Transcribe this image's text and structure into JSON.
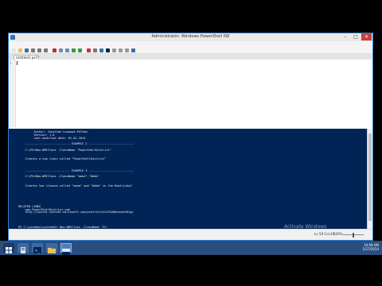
{
  "window": {
    "title": "Administrator: Windows PowerShell ISE",
    "minimize_glyph": "–",
    "maximize_glyph": "□",
    "close_glyph": "✕"
  },
  "menu": [
    "File",
    "Edit",
    "View",
    "Tools",
    "Debug",
    "Add-ons",
    "Help"
  ],
  "toolbar_icons": [
    "new-file-icon",
    "open-icon",
    "save-icon",
    "cut-icon",
    "copy-icon",
    "paste-icon",
    "clear-icon",
    "undo-icon",
    "redo-icon",
    "run-icon",
    "run-selection-icon",
    "stop-icon",
    "debug-icon",
    "remote-icon",
    "console-icon",
    "layout-icon",
    "layout-icon",
    "layout-icon",
    "commands-icon"
  ],
  "tabs": [
    {
      "label": "Untitled1.ps1*"
    }
  ],
  "editor": {
    "line_number": "1"
  },
  "console": {
    "lines": [
      "         Author: Jonathan Loxwood-Pelham",
      "         Version: 1.0",
      "         Last modified date: 01.01.2014",
      "",
      "    -------------------------- EXAMPLE 2 --------------------------",
      "",
      "    C:\\PS>New-WMIClass -ClassName \"PowerShellDistrict\"",
      "",
      "",
      "    Creates a new class called \"PowerShellDistrict\"",
      "",
      "",
      "",
      "    -------------------------- EXAMPLE 3 --------------------------",
      "",
      "    C:\\PS>New-WMIClass -ClassName \"aaaa\",\"bbbb\"",
      "",
      "",
      "    Creates two classes called \"aaaa\" and \"bbbb\" in the Root\\cimv2",
      "",
      "",
      "",
      "",
      "",
      "",
      "RELATED LINKS",
      "    www.PowerShellDistrict.com",
      "    http://social.technet.microsoft.com/profile/st%C3%A9phane%20vg/",
      "",
      "",
      "",
      "",
      "PS C:\\windows\\system32> New-WMIClass -ClassName 'FX'"
    ],
    "watermark_title": "Activate Windows",
    "watermark_sub": "Go to System in Control Panel to activate Windows."
  },
  "statusbar": {
    "position": "Ln 59  Col 49",
    "zoom": "100%"
  },
  "taskbar": {
    "icons": [
      "windows-icon",
      "server-manager-icon",
      "powershell-icon",
      "folder-icon",
      "powershell-ise-icon"
    ],
    "time": "10:09 AM",
    "date": "1/27/2014"
  },
  "colors": {
    "console_bg": "#012456",
    "taskbar_bg": "#2a4e7e",
    "accent": "#2d7fd1"
  }
}
